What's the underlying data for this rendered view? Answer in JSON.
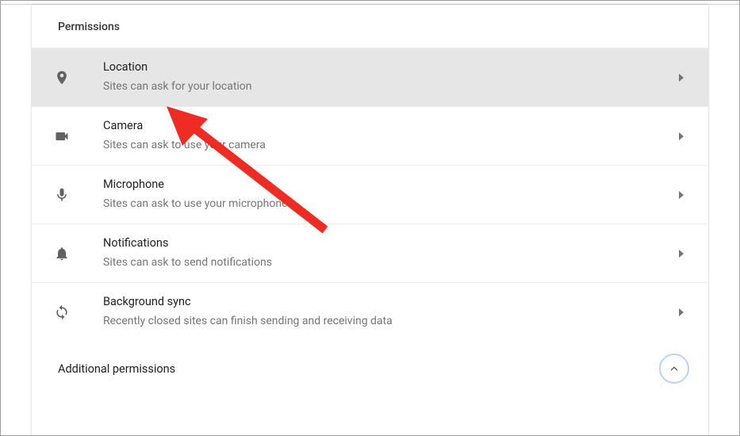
{
  "section": {
    "title": "Permissions"
  },
  "rows": [
    {
      "title": "Location",
      "sub": "Sites can ask for your location"
    },
    {
      "title": "Camera",
      "sub": "Sites can ask to use your camera"
    },
    {
      "title": "Microphone",
      "sub": "Sites can ask to use your microphone"
    },
    {
      "title": "Notifications",
      "sub": "Sites can ask to send notifications"
    },
    {
      "title": "Background sync",
      "sub": "Recently closed sites can finish sending and receiving data"
    }
  ],
  "footer": {
    "label": "Additional permissions"
  },
  "colors": {
    "arrow": "#ee2c24"
  }
}
